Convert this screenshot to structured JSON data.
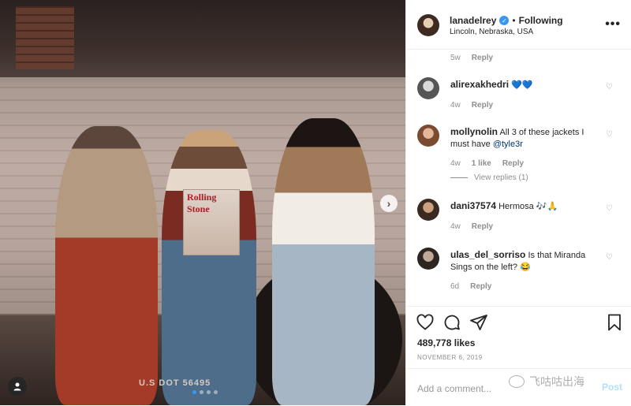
{
  "post": {
    "username": "lanadelrey",
    "verified": true,
    "follow_state": "Following",
    "separator": "•",
    "location": "Lincoln, Nebraska, USA",
    "more_icon": "more-options-icon",
    "likes": "489,778 likes",
    "date": "NOVEMBER 6, 2019"
  },
  "photo": {
    "magazine_text": "Rolling Stone",
    "plate_text": "U.S DOT 56495",
    "carousel_count": 4,
    "carousel_active": 1
  },
  "comments": {
    "top_time": "5w",
    "top_reply": "Reply",
    "items": [
      {
        "user": "alirexakhedri",
        "text": "💙💙",
        "time": "4w",
        "likes": "",
        "reply": "Reply",
        "view_replies": ""
      },
      {
        "user": "mollynolin",
        "text_before": "All 3 of these jackets I must have ",
        "mention": "@tyle3r",
        "time": "4w",
        "likes": "1 like",
        "reply": "Reply",
        "view_replies": "View replies (1)"
      },
      {
        "user": "dani37574",
        "text": "Hermosa 🎶🙏",
        "time": "4w",
        "likes": "",
        "reply": "Reply",
        "view_replies": ""
      },
      {
        "user": "ulas_del_sorriso",
        "text": "Is that Miranda Sings on the left? 😂",
        "time": "6d",
        "likes": "",
        "reply": "Reply",
        "view_replies": ""
      }
    ]
  },
  "actions": {
    "like_icon": "heart-icon",
    "comment_icon": "comment-icon",
    "share_icon": "share-icon",
    "save_icon": "bookmark-icon"
  },
  "add_comment": {
    "placeholder": "Add a comment...",
    "post_label": "Post"
  },
  "watermark": {
    "text": "飞咕咕出海"
  },
  "colors": {
    "link_blue": "#3897f0",
    "post_disabled": "#b2dffc",
    "mention": "#003569"
  }
}
